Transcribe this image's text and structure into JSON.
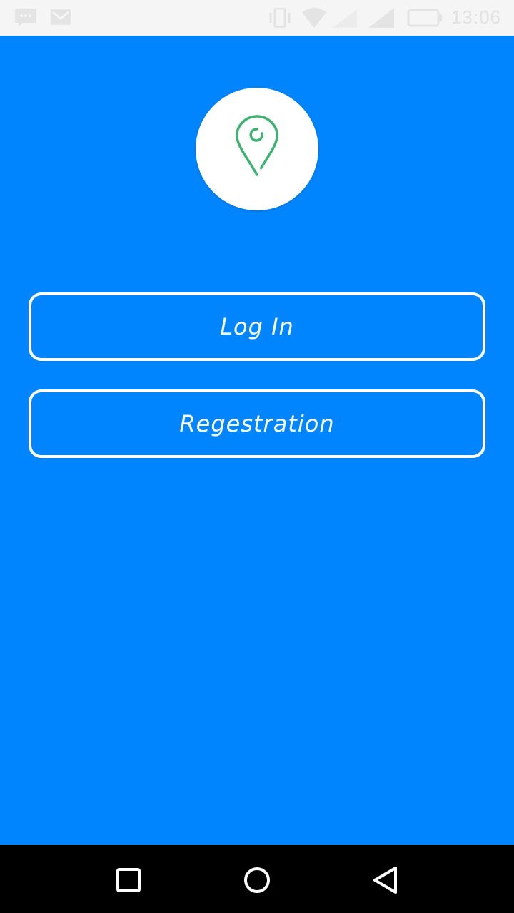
{
  "status_bar": {
    "time": "13:06",
    "icons": [
      "message-icon",
      "gmail-icon",
      "vibrate-icon",
      "wifi-icon",
      "signal-icon",
      "battery-icon"
    ]
  },
  "app": {
    "logo_icon": "location-pin-icon",
    "accent_color": "#0085ff",
    "pin_color": "#3cb371"
  },
  "buttons": {
    "login_label": "Log In",
    "register_label": "Regestration"
  },
  "nav_bar": {
    "icons": [
      "recents-square-icon",
      "home-circle-icon",
      "back-triangle-icon"
    ]
  }
}
